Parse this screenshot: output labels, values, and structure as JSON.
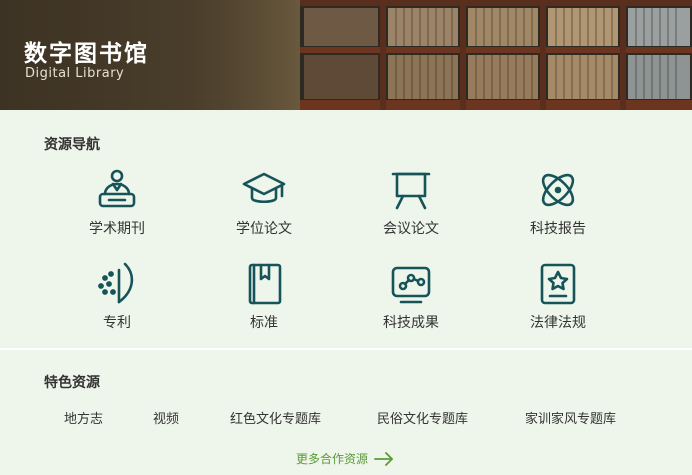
{
  "header": {
    "title": "数字图书馆",
    "subtitle": "Digital Library"
  },
  "resource_nav": {
    "title": "资源导航",
    "items": [
      {
        "label": "学术期刊",
        "icon": "journal-reader-icon"
      },
      {
        "label": "学位论文",
        "icon": "graduation-cap-icon"
      },
      {
        "label": "会议论文",
        "icon": "presentation-board-icon"
      },
      {
        "label": "科技报告",
        "icon": "atom-icon"
      },
      {
        "label": "专利",
        "icon": "patent-idea-icon"
      },
      {
        "label": "标准",
        "icon": "bookmark-book-icon"
      },
      {
        "label": "科技成果",
        "icon": "achievement-screen-icon"
      },
      {
        "label": "法律法规",
        "icon": "star-badge-icon"
      }
    ]
  },
  "featured": {
    "title": "特色资源",
    "links": [
      "地方志",
      "视频",
      "红色文化专题库",
      "民俗文化专题库",
      "家训家风专题库"
    ],
    "more_label": "更多合作资源"
  },
  "colors": {
    "icon": "#16545a",
    "accent": "#5a9a3a",
    "background": "#eef5ea"
  }
}
